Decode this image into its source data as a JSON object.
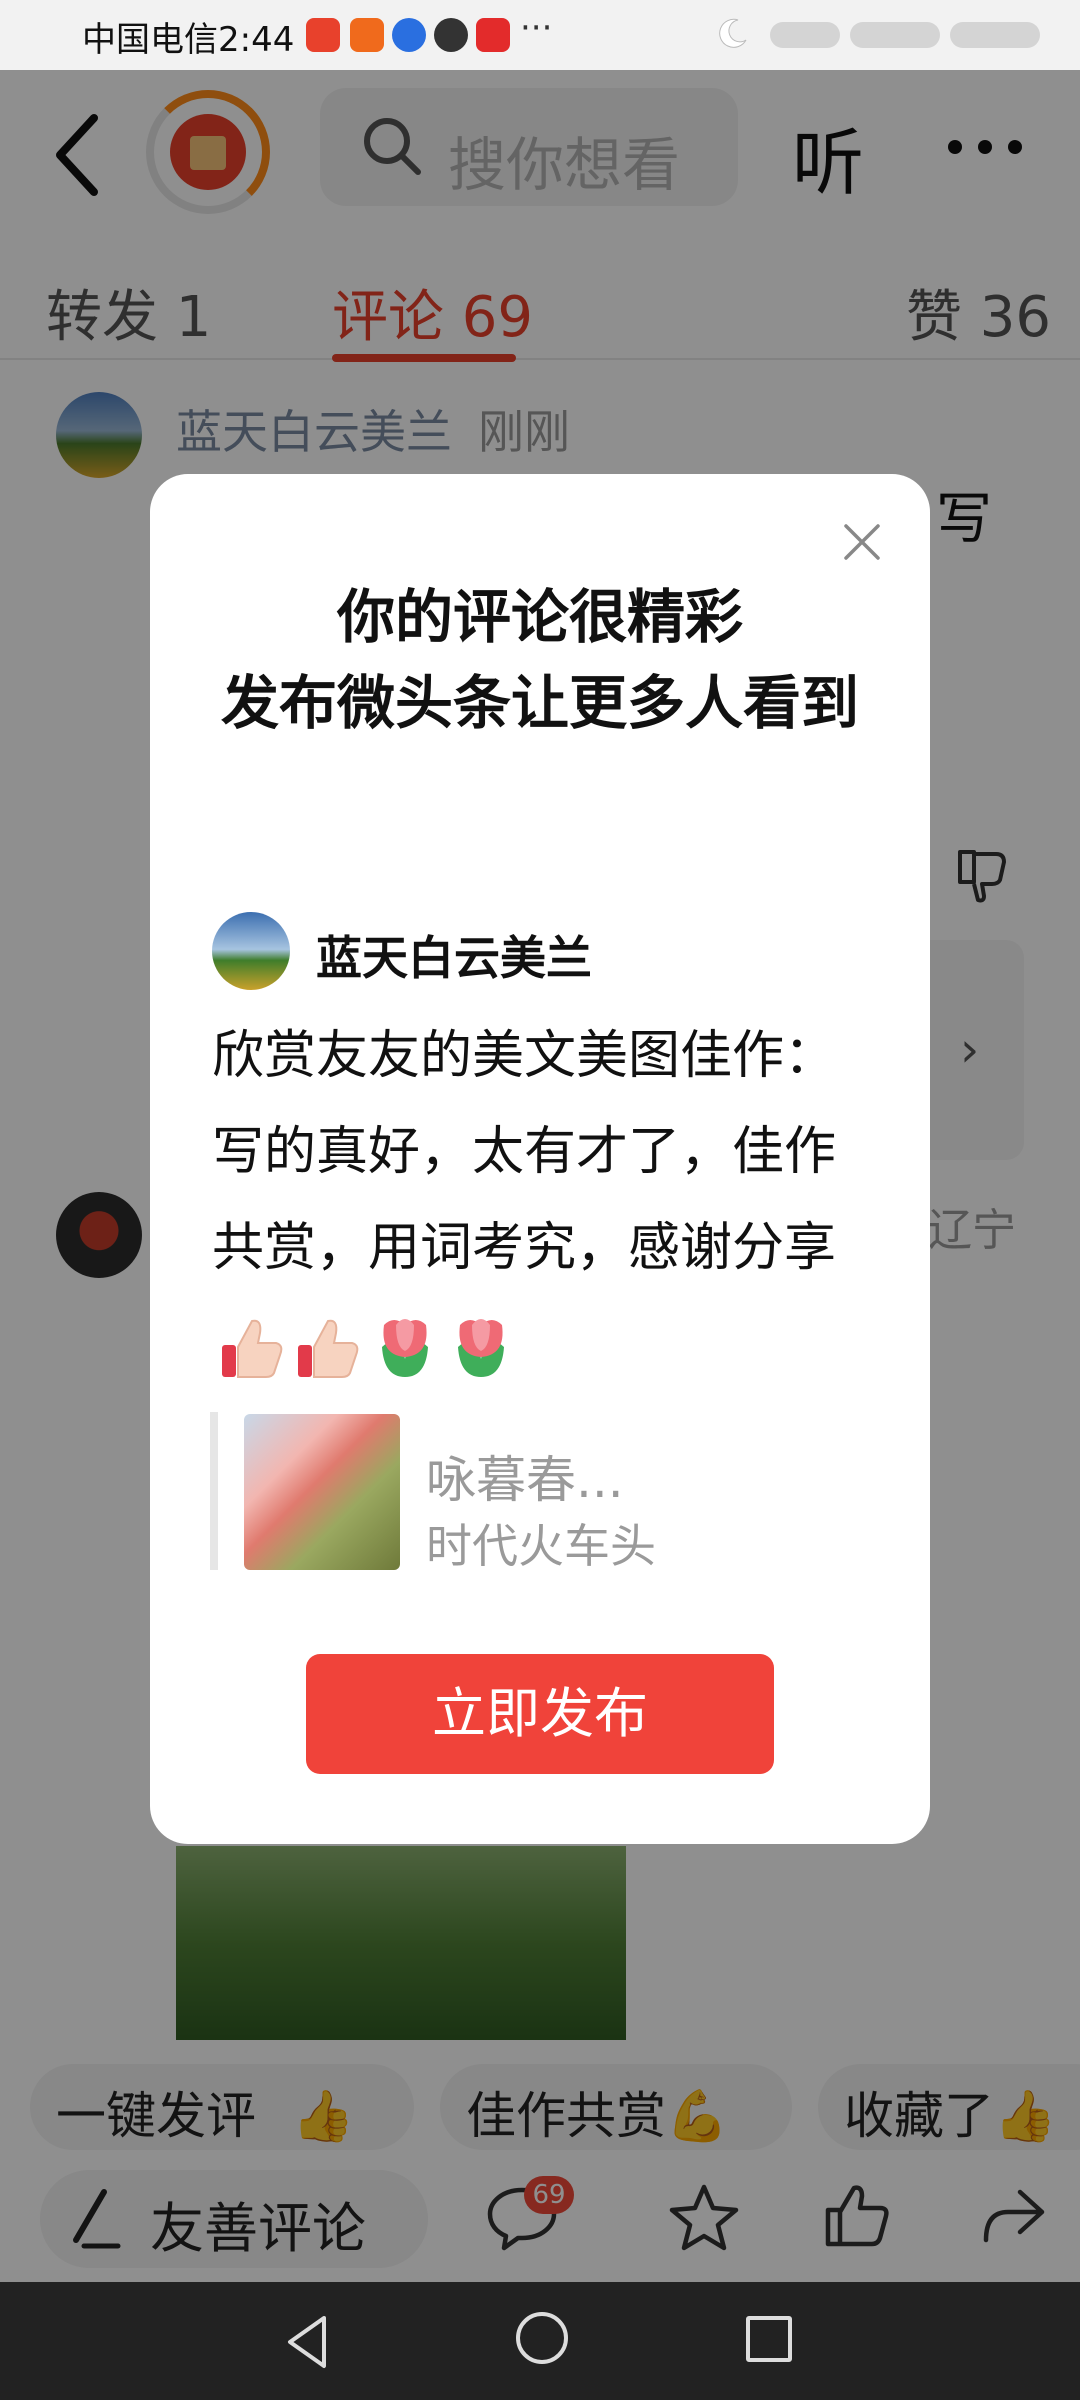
{
  "status_bar": {
    "carrier_time": "中国电信2:44",
    "more": "···"
  },
  "header": {
    "search_placeholder": "搜你想看",
    "listen_label": "听"
  },
  "tabs": [
    {
      "label": "转发 1"
    },
    {
      "label": "评论 69",
      "active": true
    },
    {
      "label": "赞 36"
    }
  ],
  "background_comments": {
    "first": {
      "user": "蓝天白云美兰",
      "time": "刚刚",
      "fragment": "写"
    },
    "second": {
      "location": "辽宁"
    }
  },
  "modal": {
    "title_line1": "你的评论很精彩",
    "title_line2": "发布微头条让更多人看到",
    "author": "蓝天白云美兰",
    "comment_text": "欣赏友友的美文美图佳作：写的真好，太有才了，佳作共赏，用词考究，感谢分享",
    "quote_title": "咏暮春...",
    "quote_source": "时代火车头",
    "publish_label": "立即发布",
    "emoji": [
      "thumbs-up",
      "thumbs-up",
      "tulip",
      "tulip"
    ]
  },
  "quick_replies": [
    "一键发评",
    "佳作共赏",
    "收藏了"
  ],
  "bottom_bar": {
    "comment_placeholder": "友善评论",
    "comments_count": "69"
  },
  "colors": {
    "accent": "#e8412c",
    "publish_button": "#f0433a",
    "overlay": "rgba(0,0,0,0.44)"
  }
}
